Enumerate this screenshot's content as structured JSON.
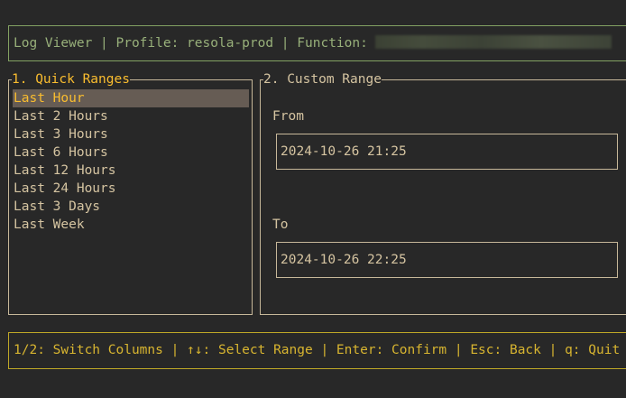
{
  "header": {
    "text": "Log Viewer | Profile: resola-prod | Function:"
  },
  "quick_ranges": {
    "title": "1. Quick Ranges",
    "items": [
      {
        "label": "Last Hour",
        "selected": true
      },
      {
        "label": "Last 2 Hours",
        "selected": false
      },
      {
        "label": "Last 3 Hours",
        "selected": false
      },
      {
        "label": "Last 6 Hours",
        "selected": false
      },
      {
        "label": "Last 12 Hours",
        "selected": false
      },
      {
        "label": "Last 24 Hours",
        "selected": false
      },
      {
        "label": "Last 3 Days",
        "selected": false
      },
      {
        "label": "Last Week",
        "selected": false
      }
    ]
  },
  "custom_range": {
    "title": "2. Custom Range",
    "from_label": "From",
    "from_value": "2024-10-26 21:25",
    "to_label": "To",
    "to_value": "2024-10-26 22:25"
  },
  "footer": {
    "help_text": "1/2: Switch Columns | ↑↓: Select Range | Enter: Confirm | Esc: Back | q: Quit"
  },
  "colors": {
    "background": "#282828",
    "header_border": "#83a262",
    "panel_border": "#c7b89a",
    "accent": "#fabd2f",
    "selection_bg": "#665c54",
    "footer_border": "#bfa827"
  }
}
